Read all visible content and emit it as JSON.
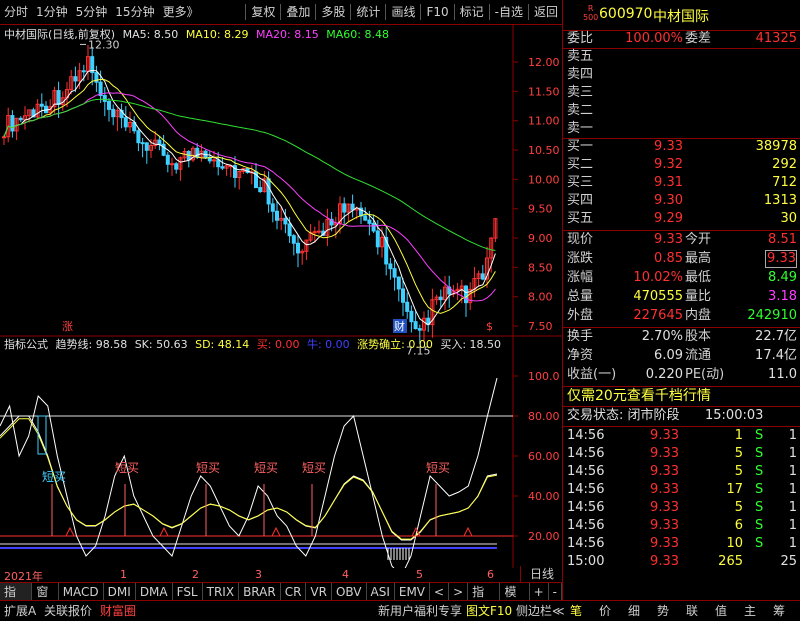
{
  "toolbar": {
    "periods": [
      "分时",
      "1分钟",
      "5分钟",
      "15分钟",
      "更多》"
    ],
    "tools": [
      "复权",
      "叠加",
      "多股",
      "统计",
      "画线",
      "F10",
      "标记",
      "-自选",
      "返回"
    ]
  },
  "legend": {
    "stock_name": "中材国际(日线,前复权)",
    "ma5": "MA5: 8.50",
    "ma10": "MA10: 8.29",
    "ma20": "MA20: 8.15",
    "ma60": "MA60: 8.48",
    "high_label": "12.30",
    "low_label": "7.15",
    "mark_zhang": "涨",
    "mark_cai": "财",
    "mark_dollar": "$"
  },
  "indicator": {
    "name": "指标公式",
    "trend": "趋势线: 98.58",
    "sk": "SK: 50.63",
    "sd": "SD: 48.14",
    "buy": "买: 0.00",
    "niu": "牛: 0.00",
    "trend_confirm": "涨势确立: 0.00",
    "buy_in": "买入: 18.50",
    "short_buy": "短买",
    "y_labels": [
      "100.0",
      "80.00",
      "60.00",
      "40.00",
      "20.00"
    ]
  },
  "axis": {
    "price_labels": [
      "12.00",
      "11.50",
      "11.00",
      "10.50",
      "10.00",
      "9.50",
      "9.00",
      "8.50",
      "8.00",
      "7.50"
    ],
    "time_labels": [
      "2021年",
      "1",
      "2",
      "3",
      "4",
      "5",
      "6"
    ],
    "daily_label": "日线"
  },
  "tabs": [
    "指标A",
    "窗口",
    "MACD",
    "DMI",
    "DMA",
    "FSL",
    "TRIX",
    "BRAR",
    "CR",
    "VR",
    "OBV",
    "ASI",
    "EMV",
    "<",
    ">",
    "指标B",
    "模 板",
    "+",
    "-"
  ],
  "quote": {
    "code": "600970",
    "name": "中材国际",
    "badge_top": "R",
    "badge_bottom": "500",
    "weibi_label": "委比",
    "weibi_value": "100.00%",
    "weicha_label": "委差",
    "weicha_value": "41325",
    "sell": [
      "卖五",
      "卖四",
      "卖三",
      "卖二",
      "卖一"
    ],
    "buy": [
      {
        "label": "买一",
        "price": "9.33",
        "vol": "38978"
      },
      {
        "label": "买二",
        "price": "9.32",
        "vol": "292"
      },
      {
        "label": "买三",
        "price": "9.31",
        "vol": "712"
      },
      {
        "label": "买四",
        "price": "9.30",
        "vol": "1313"
      },
      {
        "label": "买五",
        "price": "9.29",
        "vol": "30"
      }
    ],
    "stats": [
      {
        "l1": "现价",
        "v1": "9.33",
        "l2": "今开",
        "v2": "8.51"
      },
      {
        "l1": "涨跌",
        "v1": "0.85",
        "l2": "最高",
        "v2": "9.33"
      },
      {
        "l1": "涨幅",
        "v1": "10.02%",
        "l2": "最低",
        "v2": "8.49"
      },
      {
        "l1": "总量",
        "v1": "470555",
        "l2": "量比",
        "v2": "3.18"
      },
      {
        "l1": "外盘",
        "v1": "227645",
        "l2": "内盘",
        "v2": "242910"
      }
    ],
    "fundamentals": [
      {
        "l1": "换手",
        "v1": "2.70%",
        "l2": "股本",
        "v2": "22.7亿"
      },
      {
        "l1": "净资",
        "v1": "6.09",
        "l2": "流通",
        "v2": "17.4亿"
      },
      {
        "l1": "收益(一)",
        "v1": "0.220",
        "l2": "PE(动)",
        "v2": "11.0"
      }
    ],
    "promo": "仅需20元查看千档行情",
    "status_label": "交易状态: 闭市阶段",
    "status_time": "15:00:03",
    "ticks": [
      {
        "t": "14:56",
        "p": "9.33",
        "v": "1",
        "s": "S",
        "n": "1"
      },
      {
        "t": "14:56",
        "p": "9.33",
        "v": "5",
        "s": "S",
        "n": "1"
      },
      {
        "t": "14:56",
        "p": "9.33",
        "v": "5",
        "s": "S",
        "n": "1"
      },
      {
        "t": "14:56",
        "p": "9.33",
        "v": "17",
        "s": "S",
        "n": "1"
      },
      {
        "t": "14:56",
        "p": "9.33",
        "v": "5",
        "s": "S",
        "n": "1"
      },
      {
        "t": "14:56",
        "p": "9.33",
        "v": "6",
        "s": "S",
        "n": "1"
      },
      {
        "t": "14:56",
        "p": "9.33",
        "v": "10",
        "s": "S",
        "n": "1"
      },
      {
        "t": "15:00",
        "p": "9.33",
        "v": "265",
        "s": "",
        "n": "25"
      }
    ]
  },
  "bottombar": {
    "left": [
      "扩展A",
      "关联报价",
      "财富圈"
    ],
    "right": [
      "新用户福利专享",
      "图文F10",
      "侧边栏≪"
    ],
    "side_tabs": [
      "笔",
      "价",
      "细",
      "势",
      "联",
      "值",
      "主",
      "筹"
    ]
  }
}
